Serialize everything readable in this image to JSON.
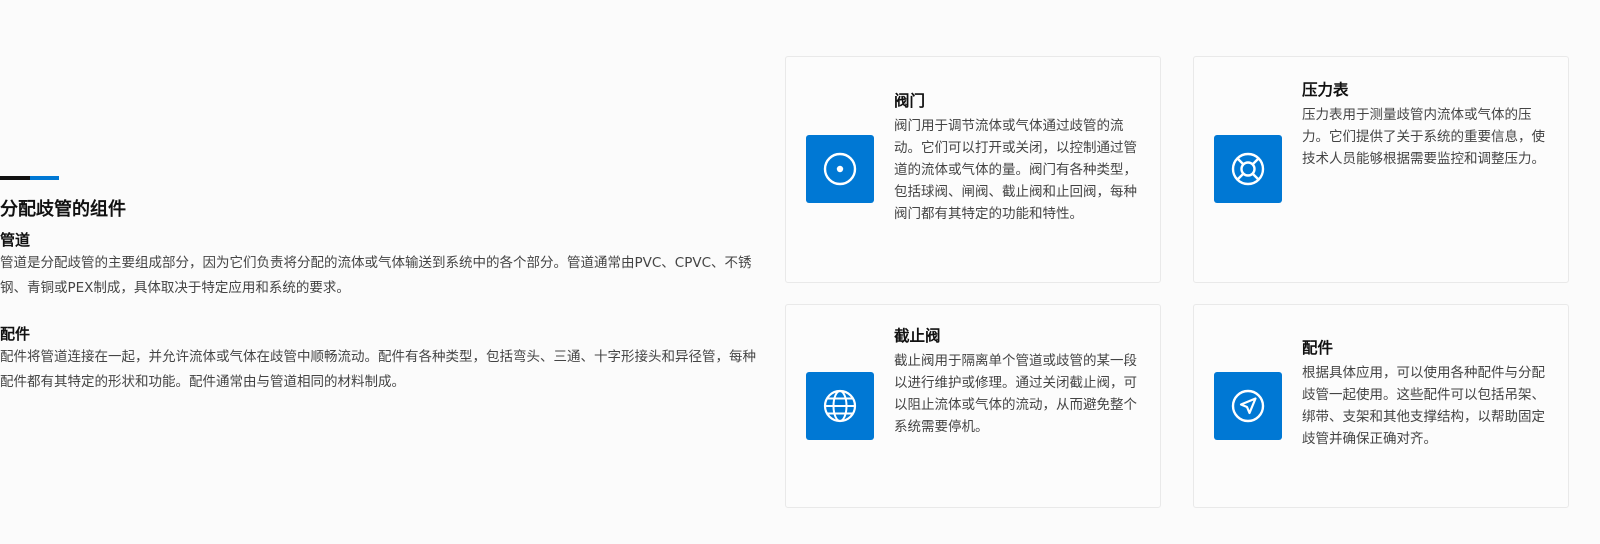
{
  "section": {
    "title": "分配歧管的组件",
    "items": [
      {
        "title": "管道",
        "text": "管道是分配歧管的主要组成部分，因为它们负责将分配的流体或气体输送到系统中的各个部分。管道通常由PVC、CPVC、不锈钢、青铜或PEX制成，具体取决于特定应用和系统的要求。"
      },
      {
        "title": "配件",
        "text": "配件将管道连接在一起，并允许流体或气体在歧管中顺畅流动。配件有各种类型，包括弯头、三通、十字形接头和异径管，每种配件都有其特定的形状和功能。配件通常由与管道相同的材料制成。"
      }
    ]
  },
  "cards": [
    {
      "icon": "target-icon",
      "title": "阀门",
      "desc": "阀门用于调节流体或气体通过歧管的流动。它们可以打开或关闭，以控制通过管道的流体或气体的量。阀门有各种类型，包括球阀、闸阀、截止阀和止回阀，每种阀门都有其特定的功能和特性。"
    },
    {
      "icon": "lifebuoy-icon",
      "title": "压力表",
      "desc": "压力表用于测量歧管内流体或气体的压力。它们提供了关于系统的重要信息，使技术人员能够根据需要监控和调整压力。"
    },
    {
      "icon": "globe-icon",
      "title": "截止阀",
      "desc": "截止阀用于隔离单个管道或歧管的某一段以进行维护或修理。通过关闭截止阀，可以阻止流体或气体的流动，从而避免整个系统需要停机。"
    },
    {
      "icon": "navigation-icon",
      "title": "配件",
      "desc": "根据具体应用，可以使用各种配件与分配歧管一起使用。这些配件可以包括吊架、绑带、支架和其他支撑结构，以帮助固定歧管并确保正确对齐。"
    }
  ],
  "colors": {
    "accent": "#0078d4",
    "dark": "#111111"
  }
}
